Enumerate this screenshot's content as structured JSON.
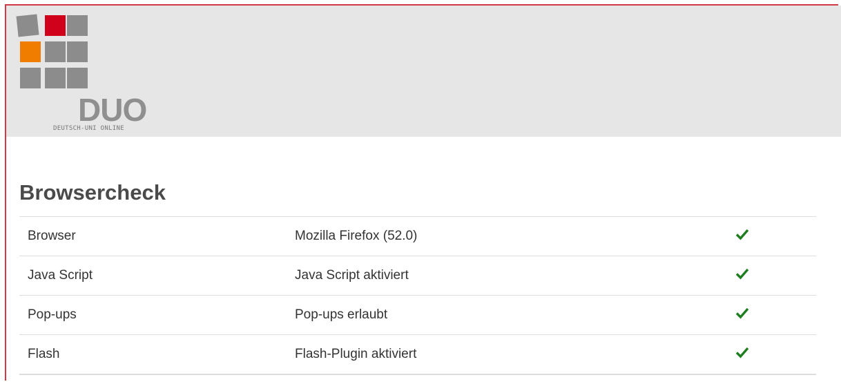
{
  "logo": {
    "name": "DUO",
    "subtitle": "DEUTSCH-UNI ONLINE",
    "colors": {
      "gray": "#8c8c8c",
      "red": "#d0021b",
      "orange": "#f07d00"
    }
  },
  "page": {
    "title": "Browsercheck"
  },
  "checks": [
    {
      "label": "Browser",
      "value": "Mozilla Firefox (52.0)",
      "status": "check-icon"
    },
    {
      "label": "Java Script",
      "value": "Java Script aktiviert",
      "status": "check-icon"
    },
    {
      "label": "Pop-ups",
      "value": "Pop-ups erlaubt",
      "status": "check-icon"
    },
    {
      "label": "Flash",
      "value": "Flash-Plugin aktiviert",
      "status": "check-icon"
    }
  ],
  "colors": {
    "frame": "#d13a44",
    "header_bg": "#e6e6e7",
    "check": "#1e7d1e"
  }
}
